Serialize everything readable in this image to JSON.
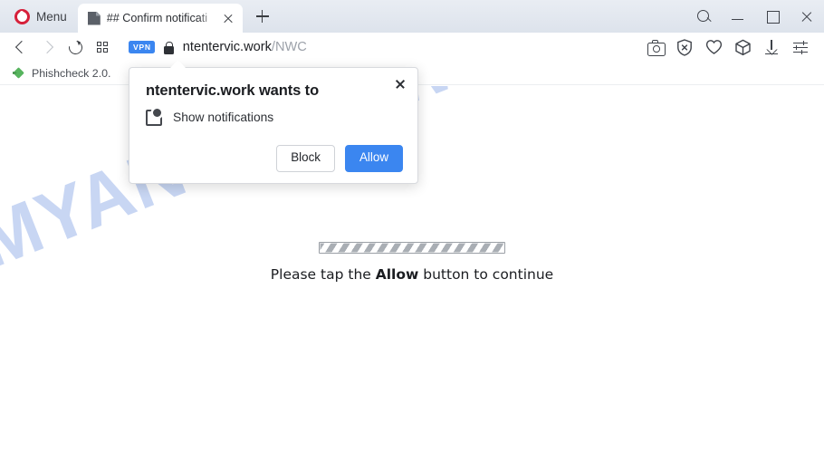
{
  "browser": {
    "menu_label": "Menu",
    "opera_logo_icon": "opera-logo-icon",
    "tab": {
      "favicon": "page-favicon-icon",
      "title": "## Confirm notificati",
      "close_icon": "close-icon"
    },
    "new_tab_icon": "plus-icon",
    "window_controls": {
      "search_icon": "search-icon",
      "minimize_icon": "minimize-icon",
      "maximize_icon": "maximize-icon",
      "close_icon": "close-icon"
    },
    "toolbar": {
      "back_icon": "back-arrow-icon",
      "forward_icon": "forward-arrow-icon",
      "reload_icon": "reload-icon",
      "tab_grid_icon": "grid-icon",
      "vpn_badge": "VPN",
      "lock_icon": "lock-icon",
      "url_host": "ntentervic.work",
      "url_path": "/NWC",
      "right_icons": [
        "camera-icon",
        "shield-block-icon",
        "heart-icon",
        "cube-icon",
        "download-icon",
        "sliders-icon"
      ]
    },
    "bookmarks": [
      {
        "icon": "phishcheck-icon",
        "label": "Phishcheck 2.0."
      }
    ]
  },
  "permission_dialog": {
    "close_icon": "close-icon",
    "title": "ntentervic.work wants to",
    "permission_icon": "notification-icon",
    "permission_label": "Show notifications",
    "block_label": "Block",
    "allow_label": "Allow",
    "allow_color": "#3b86f0"
  },
  "page": {
    "watermark": "MYANTISPYWARE.COM",
    "watermark_color": "#c6d4f3",
    "progress_label_prefix": "Please tap the ",
    "progress_label_emphasis": "Allow",
    "progress_label_suffix": " button to continue"
  }
}
